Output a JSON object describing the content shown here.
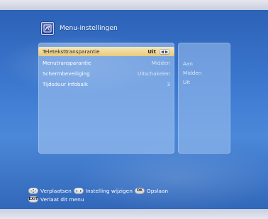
{
  "header": {
    "title": "Menu-instellingen",
    "icon": "settings-menu-icon"
  },
  "settings": {
    "rows": [
      {
        "label": "Teleteksttransparantie",
        "value": "Uit",
        "selected": true
      },
      {
        "label": "Menutransparantie",
        "value": "Midden",
        "selected": false
      },
      {
        "label": "Schermbeveiliging",
        "value": "Uitschakelen",
        "selected": false
      },
      {
        "label": "Tijdsduur infobalk",
        "value": "3",
        "selected": false
      }
    ]
  },
  "options_panel": {
    "items": [
      "Aan",
      "Midden",
      "Uit"
    ]
  },
  "footer": {
    "line1": {
      "move_label": "Verplaatsen",
      "change_label": "Instelling wijzigen",
      "save_label": "Opslaan",
      "move_icon": "navigate-icon",
      "change_icon": "left-right-icon",
      "save_icon": "ok-button-icon",
      "save_icon_text": "OK"
    },
    "line2": {
      "exit_label": "Verlaat dit menu",
      "exit_icon": "exit-button-icon",
      "exit_icon_text": "EXIT"
    }
  },
  "colors": {
    "background_blue": "#3c78cf",
    "panel_blue": "#a0c3f0",
    "selected_row": "#e8c97a",
    "text_white": "#ffffff"
  }
}
